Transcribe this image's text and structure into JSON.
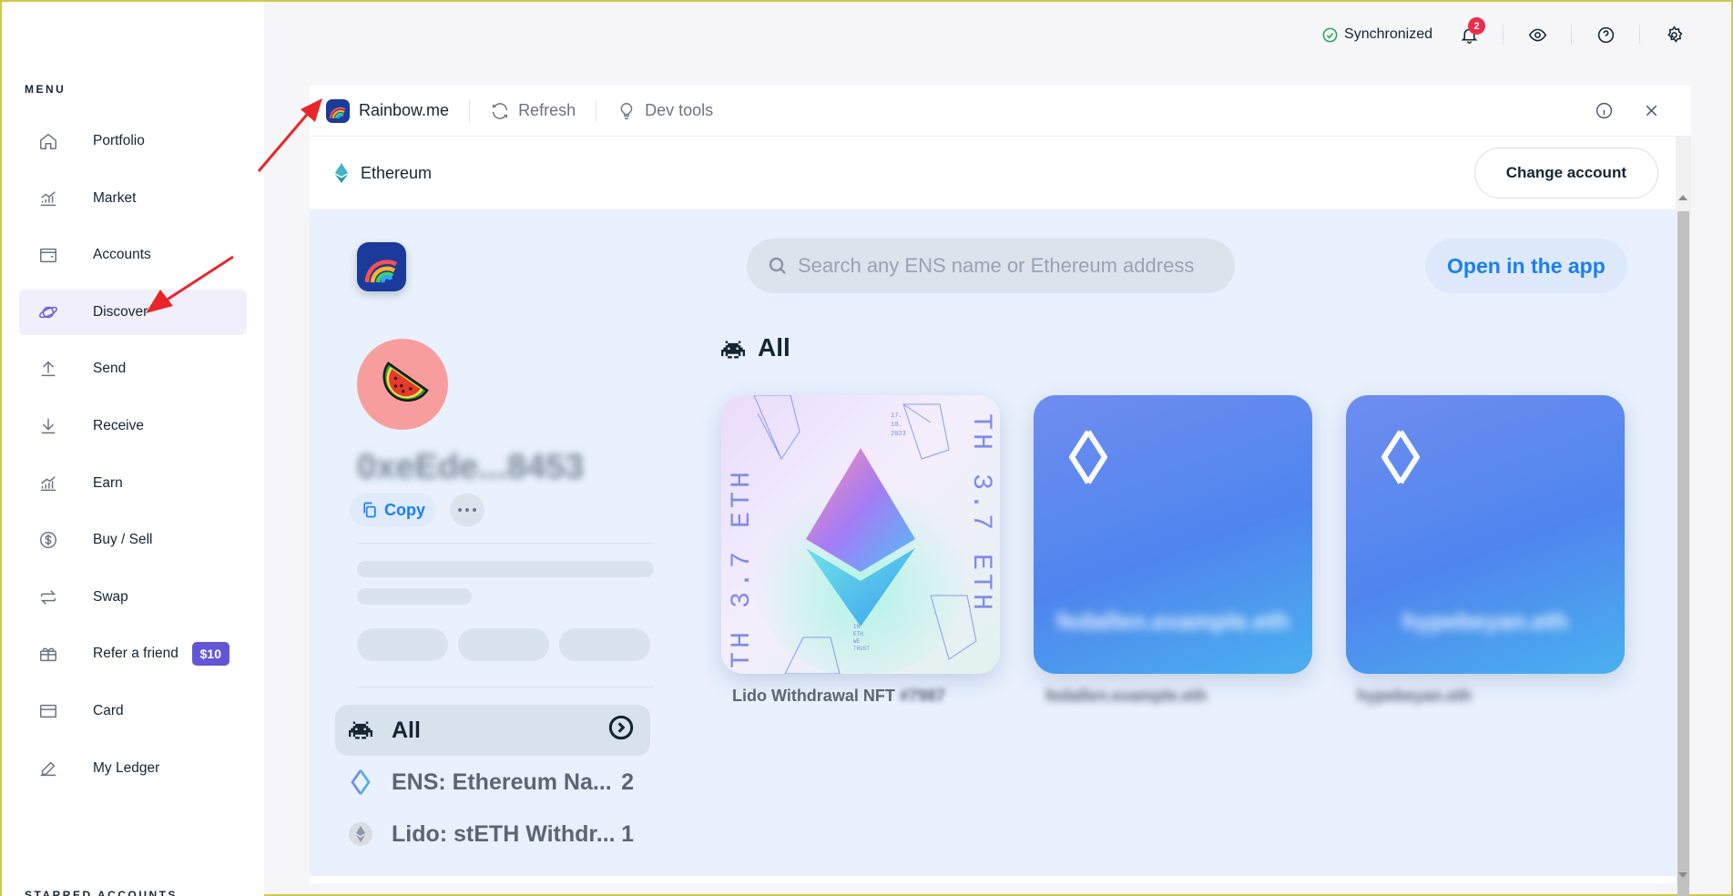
{
  "sidebar": {
    "menu_title": "MENU",
    "items": [
      {
        "label": "Portfolio",
        "icon": "home-icon"
      },
      {
        "label": "Market",
        "icon": "market-icon"
      },
      {
        "label": "Accounts",
        "icon": "wallet-icon"
      },
      {
        "label": "Discover",
        "icon": "planet-icon",
        "active": true
      },
      {
        "label": "Send",
        "icon": "send-icon"
      },
      {
        "label": "Receive",
        "icon": "receive-icon"
      },
      {
        "label": "Earn",
        "icon": "earn-icon"
      },
      {
        "label": "Buy / Sell",
        "icon": "dollar-icon"
      },
      {
        "label": "Swap",
        "icon": "swap-icon"
      },
      {
        "label": "Refer a friend",
        "icon": "gift-icon",
        "badge": "$10"
      },
      {
        "label": "Card",
        "icon": "card-icon"
      },
      {
        "label": "My Ledger",
        "icon": "ledger-icon"
      }
    ],
    "starred_title": "STARRED ACCOUNTS"
  },
  "topbar": {
    "sync_label": "Synchronized",
    "notification_count": "2",
    "colors": {
      "sync": "#22a55a",
      "badge": "#ea2e49"
    }
  },
  "panel": {
    "app_name": "Rainbow.me",
    "refresh_label": "Refresh",
    "devtools_label": "Dev tools",
    "chain_name": "Ethereum",
    "change_account_label": "Change account"
  },
  "webview": {
    "search_placeholder": "Search any ENS name or Ethereum address",
    "open_app_label": "Open in the app",
    "address": "0xeEde...8453",
    "copy_label": "Copy",
    "section_title": "All",
    "collections": [
      {
        "label": "All",
        "count": "",
        "active": true
      },
      {
        "label": "ENS: Ethereum Na...",
        "count": "2"
      },
      {
        "label": "Lido: stETH Withdr...",
        "count": "1"
      }
    ],
    "cards": [
      {
        "label": "Lido Withdrawal NFT",
        "label_suffix": "#7987",
        "art_text_left": "TH 3.7 ETH",
        "art_text_right": "TH 3.7 ETH",
        "art_date": "17.\n10.\n2023",
        "art_trust": "IN\nETH\nWE\nTRUST"
      },
      {
        "label": "fedallen.example.eth",
        "name": "fedallen.example.eth"
      },
      {
        "label": "hypebeyan.eth",
        "name": "hypebeyan.eth"
      }
    ],
    "accent": "#1a7ff0"
  }
}
